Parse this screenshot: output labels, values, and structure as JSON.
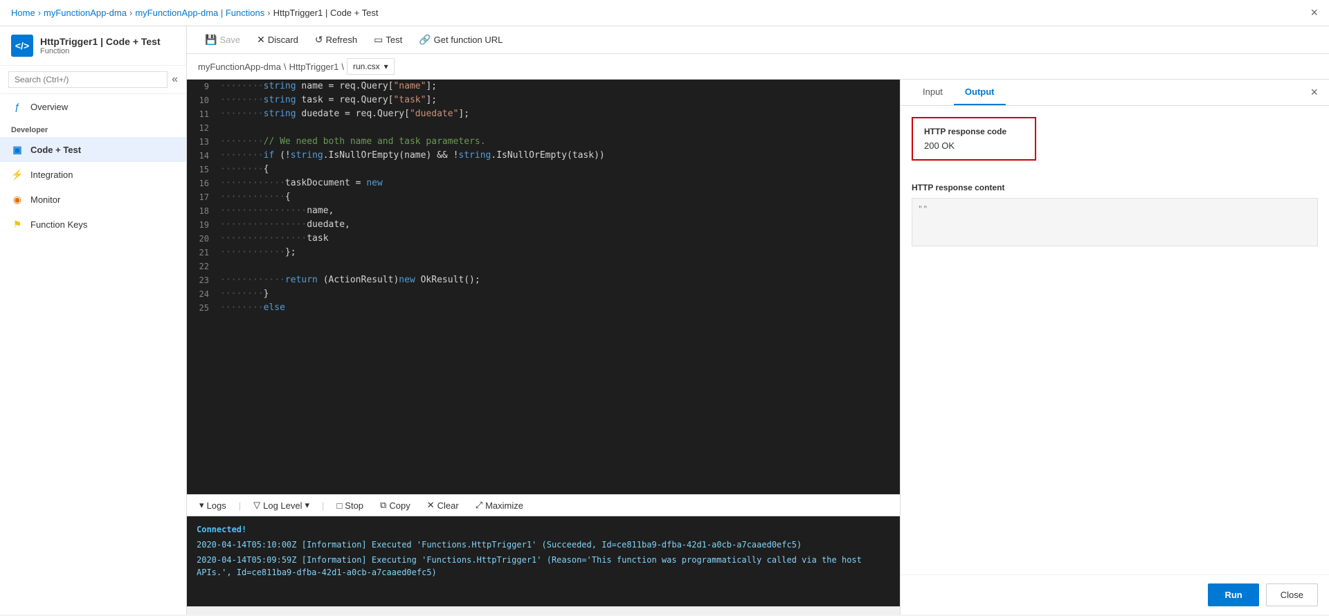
{
  "topbar": {
    "breadcrumb": [
      {
        "label": "Home",
        "link": true
      },
      {
        "label": "myFunctionApp-dma",
        "link": true
      },
      {
        "label": "myFunctionApp-dma | Functions",
        "link": true
      },
      {
        "label": "HttpTrigger1 | Code + Test",
        "link": false
      }
    ],
    "close_label": "×"
  },
  "sidebar": {
    "logo_text": "</>",
    "title": "HttpTrigger1 | Code + Test",
    "subtitle": "Function",
    "search_placeholder": "Search (Ctrl+/)",
    "collapse_icon": "«",
    "nav_items": [
      {
        "label": "Overview",
        "icon": "ƒ",
        "icon_class": "blue",
        "active": false
      },
      {
        "label": "Code + Test",
        "icon": "▣",
        "icon_class": "blue",
        "active": true
      },
      {
        "label": "Integration",
        "icon": "⚡",
        "icon_class": "yellow",
        "active": false
      },
      {
        "label": "Monitor",
        "icon": "◉",
        "icon_class": "orange",
        "active": false
      },
      {
        "label": "Function Keys",
        "icon": "⚑",
        "icon_class": "yellow",
        "active": false
      }
    ],
    "section_label": "Developer"
  },
  "toolbar": {
    "save_label": "Save",
    "discard_label": "Discard",
    "refresh_label": "Refresh",
    "test_label": "Test",
    "get_function_url_label": "Get function URL"
  },
  "code_panel": {
    "path1": "myFunctionApp-dma",
    "path2": "HttpTrigger1",
    "file_dropdown": "run.csx",
    "lines": [
      {
        "num": "9",
        "code": "    <dots>···</dots><kw>string</kw> name = req.Query[<str>\"name\"</str>];"
      },
      {
        "num": "10",
        "code": "    <dots>···</dots><kw>string</kw> task = req.Query[<str>\"task\"</str>];"
      },
      {
        "num": "11",
        "code": "    <dots>···</dots><kw>string</kw> duedate = req.Query[<str>\"duedate\"</str>];"
      },
      {
        "num": "12",
        "code": ""
      },
      {
        "num": "13",
        "code": "    <dots>···</dots><comment>// We need both name and task parameters.</comment>"
      },
      {
        "num": "14",
        "code": "    <dots>···</dots><kw>if</kw> (!<kw>string</kw>.IsNullOrEmpty(name) && !<kw>string</kw>.IsNullOrEmpty(task))"
      },
      {
        "num": "15",
        "code": "    <dots>···</dots>{"
      },
      {
        "num": "16",
        "code": "        <dots>···</dots>taskDocument = <kw>new</kw>"
      },
      {
        "num": "17",
        "code": "        <dots>···</dots>{"
      },
      {
        "num": "18",
        "code": "            <dots>···</dots>name,"
      },
      {
        "num": "19",
        "code": "            <dots>···</dots>duedate,"
      },
      {
        "num": "20",
        "code": "            <dots>···</dots>task"
      },
      {
        "num": "21",
        "code": "        <dots>···</dots>};"
      },
      {
        "num": "22",
        "code": ""
      },
      {
        "num": "23",
        "code": "        <dots>···</dots><kw>return</kw> (ActionResult)<kw>new</kw> OkResult();"
      },
      {
        "num": "24",
        "code": "    <dots>···</dots>}"
      },
      {
        "num": "25",
        "code": "    <dots>···</dots><kw>else</kw>"
      }
    ]
  },
  "logs_bar": {
    "logs_label": "Logs",
    "log_level_label": "Log Level",
    "stop_label": "Stop",
    "copy_label": "Copy",
    "clear_label": "Clear",
    "maximize_label": "Maximize"
  },
  "log_console": {
    "connected": "Connected!",
    "line1": "2020-04-14T05:10:00Z  [Information]  Executed 'Functions.HttpTrigger1' (Succeeded, Id=ce811ba9-dfba-42d1-a0cb-a7caaed0efc5)",
    "line2": "2020-04-14T05:09:59Z  [Information]  Executing 'Functions.HttpTrigger1' (Reason='This function was programmatically called via the host APIs.', Id=ce811ba9-dfba-42d1-a0cb-a7caaed0efc5)"
  },
  "right_panel": {
    "tab_input": "Input",
    "tab_output": "Output",
    "active_tab": "Output",
    "http_response_code_label": "HTTP response code",
    "http_response_code_value": "200 OK",
    "http_response_content_label": "HTTP response content",
    "http_response_content_value": "\"\"",
    "run_label": "Run",
    "close_label": "Close",
    "close_icon": "×"
  }
}
